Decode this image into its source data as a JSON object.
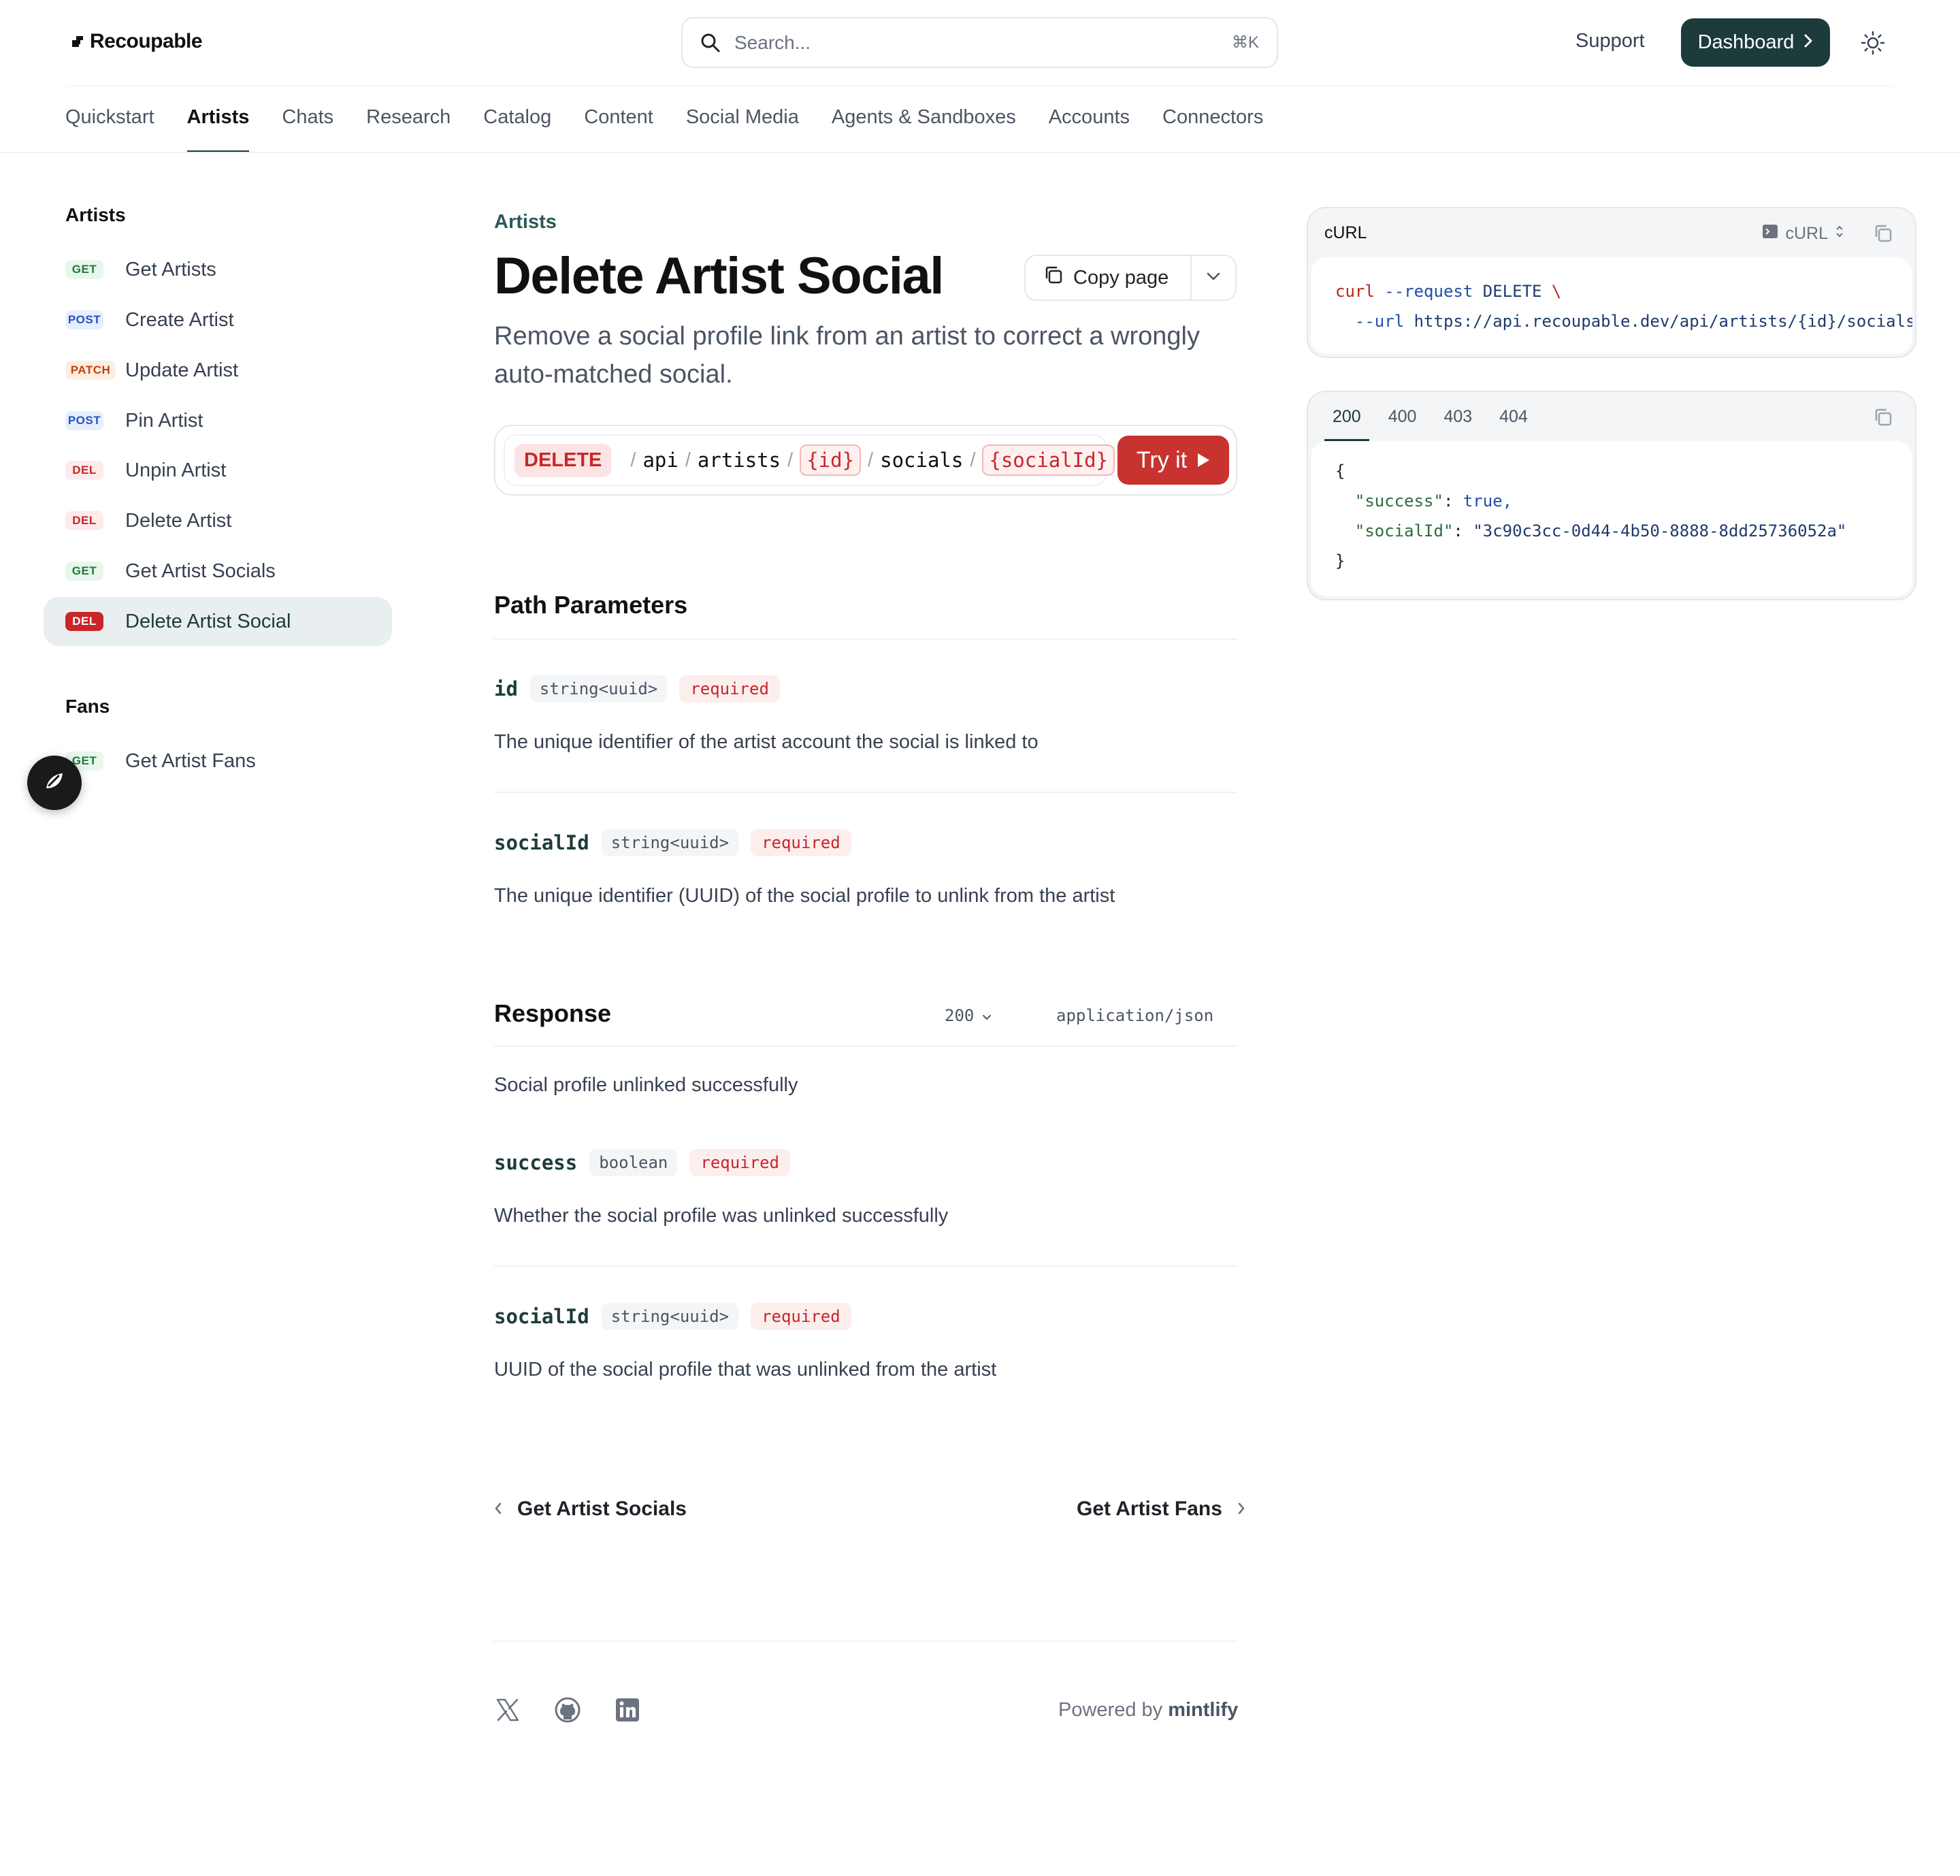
{
  "brand": {
    "name": "Recoupable"
  },
  "search": {
    "placeholder": "Search...",
    "shortcut": "⌘K"
  },
  "header": {
    "support_label": "Support",
    "dashboard_label": "Dashboard"
  },
  "nav_tabs": [
    "Quickstart",
    "Artists",
    "Chats",
    "Research",
    "Catalog",
    "Content",
    "Social Media",
    "Agents & Sandboxes",
    "Accounts",
    "Connectors"
  ],
  "active_tab": "Artists",
  "sidebar": {
    "sections": [
      {
        "title": "Artists",
        "items": [
          {
            "method": "GET",
            "label": "Get Artists"
          },
          {
            "method": "POST",
            "label": "Create Artist"
          },
          {
            "method": "PATCH",
            "label": "Update Artist"
          },
          {
            "method": "POST",
            "label": "Pin Artist"
          },
          {
            "method": "DEL",
            "label": "Unpin Artist"
          },
          {
            "method": "DEL",
            "label": "Delete Artist"
          },
          {
            "method": "GET",
            "label": "Get Artist Socials"
          },
          {
            "method": "DEL",
            "label": "Delete Artist Social",
            "active": true
          }
        ]
      },
      {
        "title": "Fans",
        "items": [
          {
            "method": "GET",
            "label": "Get Artist Fans"
          }
        ]
      }
    ]
  },
  "page": {
    "eyebrow": "Artists",
    "title": "Delete Artist Social",
    "copy_page_label": "Copy page",
    "subtitle": "Remove a social profile link from an artist to correct a wrongly auto-matched social."
  },
  "endpoint": {
    "method": "DELETE",
    "segments": [
      "api",
      "artists",
      "{id}",
      "socials",
      "{socialId}"
    ],
    "try_label": "Try it"
  },
  "path_params": {
    "heading": "Path Parameters",
    "items": [
      {
        "name": "id",
        "type": "string<uuid>",
        "required": "required",
        "description": "The unique identifier of the artist account the social is linked to"
      },
      {
        "name": "socialId",
        "type": "string<uuid>",
        "required": "required",
        "description": "The unique identifier (UUID) of the social profile to unlink from the artist"
      }
    ]
  },
  "response": {
    "heading": "Response",
    "status": "200",
    "content_type": "application/json",
    "summary": "Social profile unlinked successfully",
    "fields": [
      {
        "name": "success",
        "type": "boolean",
        "required": "required",
        "description": "Whether the social profile was unlinked successfully"
      },
      {
        "name": "socialId",
        "type": "string<uuid>",
        "required": "required",
        "description": "UUID of the social profile that was unlinked from the artist"
      }
    ]
  },
  "pager": {
    "prev": "Get Artist Socials",
    "next": "Get Artist Fans"
  },
  "footer": {
    "powered_prefix": "Powered by",
    "powered_brand": "mintlify",
    "social_icons": [
      "x-icon",
      "github-icon",
      "linkedin-icon"
    ]
  },
  "request_card": {
    "title": "cURL",
    "language": "cURL",
    "line1": {
      "cmd": "curl",
      "flag": "--request",
      "arg": "DELETE",
      "cont": "\\"
    },
    "line2": {
      "flag": "--url",
      "url": "https://api.recoupable.dev/api/artists/{id}/socials/{socialId}"
    }
  },
  "response_card": {
    "tabs": [
      "200",
      "400",
      "403",
      "404"
    ],
    "active_tab": "200",
    "open_brace": "{",
    "close_brace": "}",
    "line1": {
      "key": "\"success\"",
      "value": "true,"
    },
    "line2": {
      "key": "\"socialId\"",
      "value": "\"3c90c3cc-0d44-4b50-8888-8dd25736052a\""
    }
  },
  "colors": {
    "accent": "#1d3b3a",
    "delete": "#c8262b",
    "try_button": "#c8332f"
  }
}
